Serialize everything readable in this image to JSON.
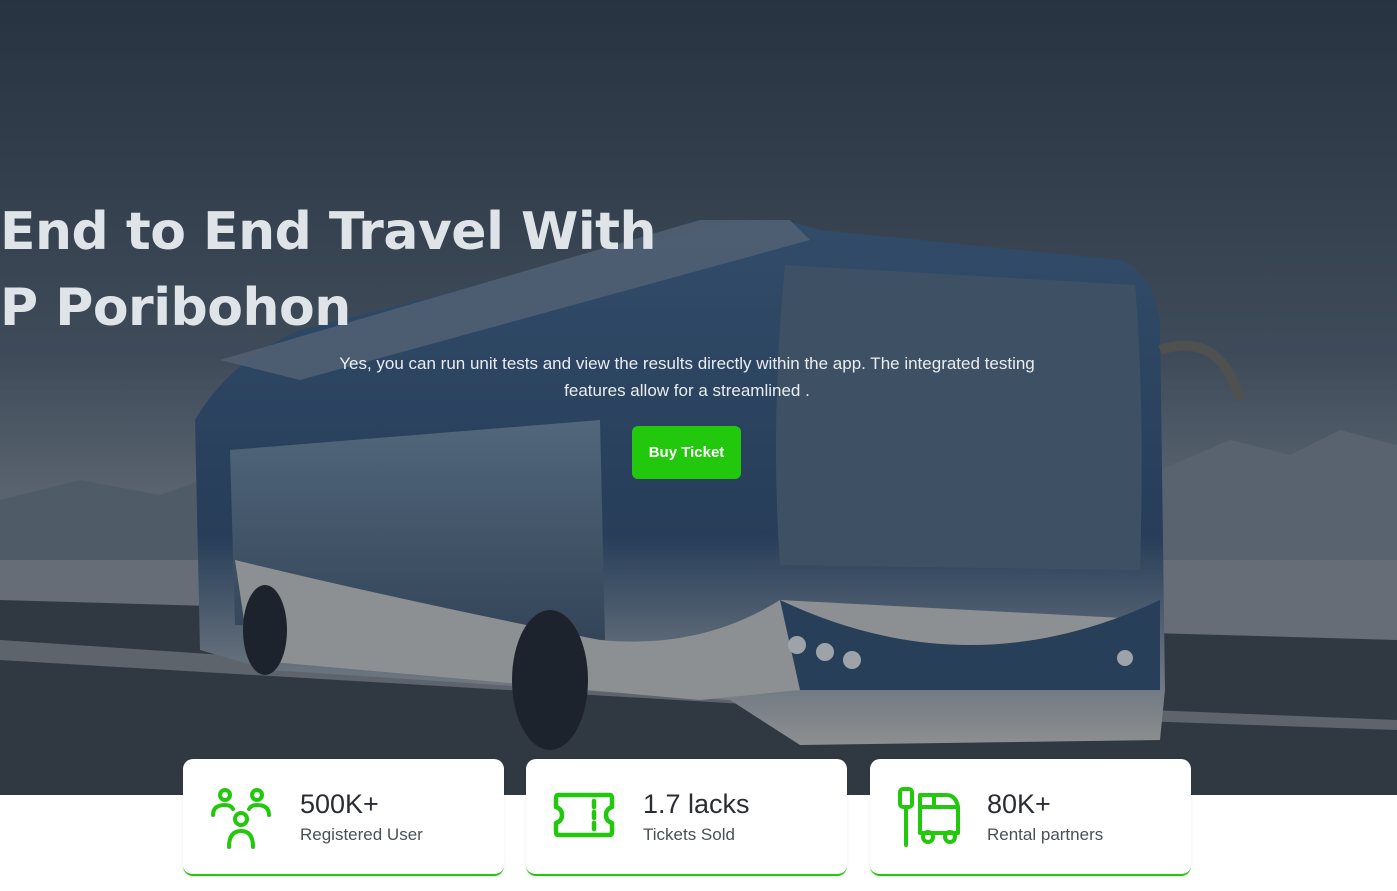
{
  "hero": {
    "title_line1": "End to End Travel With",
    "title_line2": "P Poribohon",
    "subtitle": "Yes, you can run unit tests and view the results directly within the app. The integrated testing features allow for a streamlined .",
    "buy_button": "Buy Ticket"
  },
  "stats": [
    {
      "value": "500K+",
      "label": "Registered User",
      "icon": "users-icon"
    },
    {
      "value": "1.7 lacks",
      "label": "Tickets Sold",
      "icon": "ticket-icon"
    },
    {
      "value": "80K+",
      "label": "Rental partners",
      "icon": "bus-stop-icon"
    }
  ],
  "colors": {
    "accent": "#22c80c",
    "title": "#dfe4e8",
    "stat_text": "#2a2d33"
  }
}
